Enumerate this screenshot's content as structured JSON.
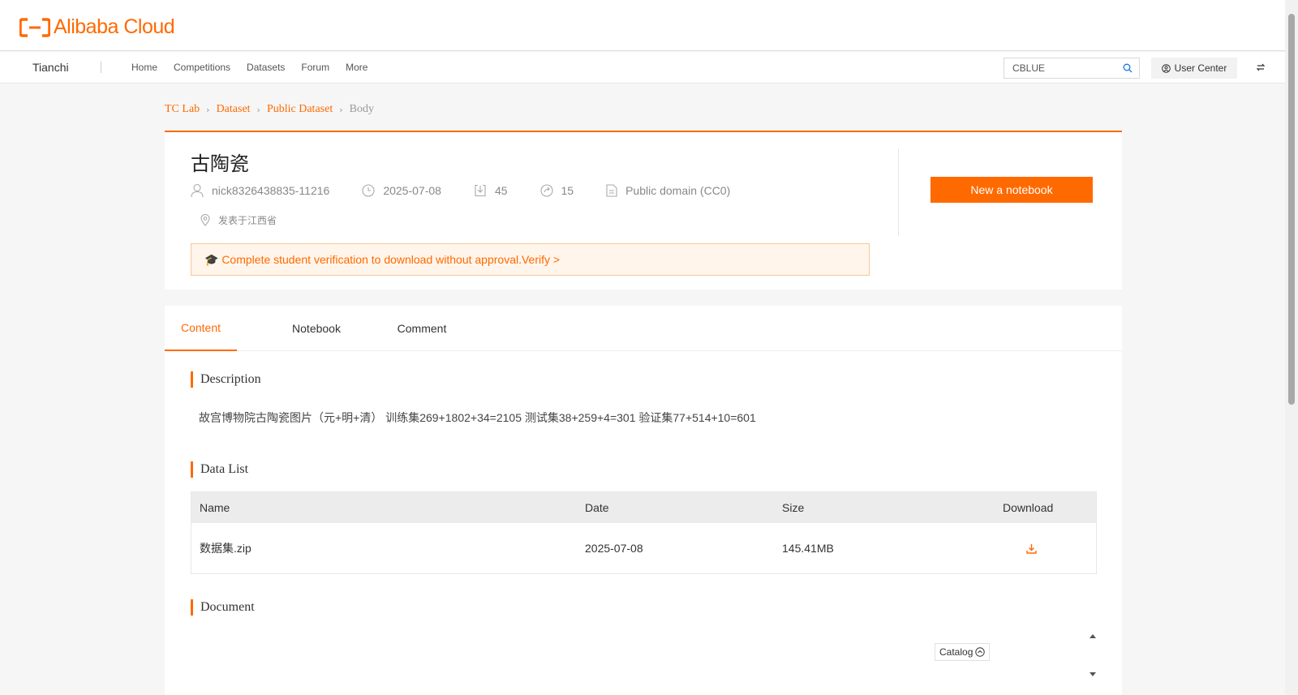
{
  "header": {
    "logo_text": "Alibaba Cloud",
    "accent_color": "#ff6a00"
  },
  "nav": {
    "brand": "Tianchi",
    "links": [
      "Home",
      "Competitions",
      "Datasets",
      "Forum",
      "More"
    ],
    "search_value": "CBLUE",
    "user_center": "User Center"
  },
  "breadcrumb": [
    "TC Lab",
    "Dataset",
    "Public Dataset",
    "Body"
  ],
  "dataset": {
    "title": "古陶瓷",
    "author": "nick8326438835-11216",
    "date": "2025-07-08",
    "downloads": "45",
    "shares": "15",
    "license": "Public domain (CC0)",
    "location": "发表于江西省",
    "verify_notice": "🎓 Complete student verification to download without approval.Verify >",
    "new_notebook_label": "New a notebook"
  },
  "tabs": [
    "Content",
    "Notebook",
    "Comment"
  ],
  "sections": {
    "description_title": "Description",
    "description_text": "故宫博物院古陶瓷图片（元+明+清） 训练集269+1802+34=2105 测试集38+259+4=301 验证集77+514+10=601",
    "data_list_title": "Data List",
    "document_title": "Document",
    "catalog_label": "Catalog"
  },
  "table": {
    "headers": [
      "Name",
      "Date",
      "Size",
      "Download"
    ],
    "rows": [
      {
        "name": "数据集.zip",
        "date": "2025-07-08",
        "size": "145.41MB"
      }
    ]
  }
}
